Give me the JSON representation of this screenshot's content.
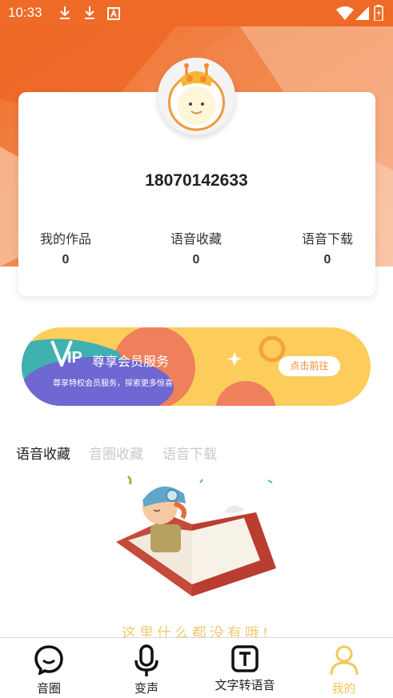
{
  "status_bar": {
    "time": "10:33"
  },
  "profile": {
    "phone": "18070142633",
    "stats": [
      {
        "label": "我的作品",
        "value": "0"
      },
      {
        "label": "语音收藏",
        "value": "0"
      },
      {
        "label": "语音下载",
        "value": "0"
      }
    ]
  },
  "vip": {
    "badge": "IP",
    "title": "尊享会员服务",
    "subtitle": "尊享特权会员服务，探索更多惊喜",
    "button": "点击前往"
  },
  "tabs": [
    {
      "label": "语音收藏",
      "active": true
    },
    {
      "label": "音圈收藏",
      "active": false
    },
    {
      "label": "语音下载",
      "active": false
    }
  ],
  "empty": {
    "message": "这里什么都没有哦!"
  },
  "nav": [
    {
      "label": "音圈",
      "icon": "chat-bubble-icon"
    },
    {
      "label": "变声",
      "icon": "microphone-icon"
    },
    {
      "label": "文字转语音",
      "icon": "text-box-icon"
    },
    {
      "label": "我的",
      "icon": "person-icon",
      "active": true
    }
  ],
  "colors": {
    "accent": "#ee6a26",
    "vip_yellow": "#fccd5b",
    "nav_active": "#f5c75a"
  }
}
